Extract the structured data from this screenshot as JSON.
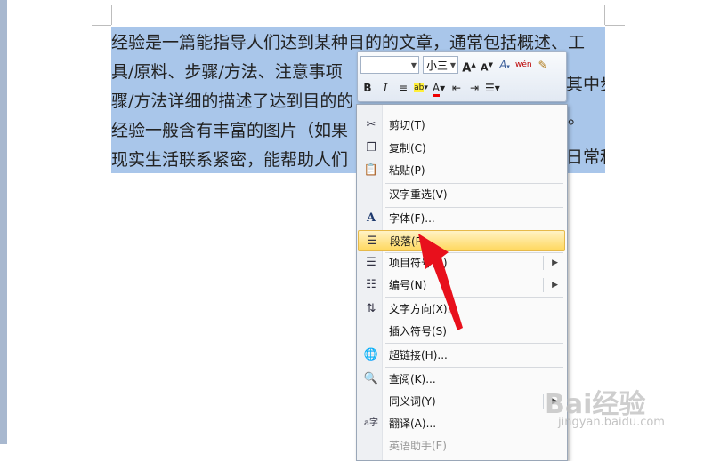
{
  "document": {
    "lines": [
      "经验是一篇能指导人们达到某种目的的文章，通常包括概述、工",
      "具/原料、步骤/方法、注意事项",
      "骤/方法详细的描述了达到目的的",
      "经验一般含有丰富的图片（如果",
      "现实生活联系紧密，能帮助人们"
    ],
    "line2_tail": "其中步",
    "line3_tail": "模仿。",
    "line4_tail": "日常和"
  },
  "mini_toolbar": {
    "font_name": "",
    "font_size": "小三",
    "buttons_row1": [
      "A",
      "A",
      "A",
      "wén",
      "brush"
    ],
    "buttons_row2": [
      "B",
      "I",
      "≡",
      "ab",
      "A",
      "⇤",
      "⇥",
      "☰"
    ]
  },
  "context_menu": {
    "items": [
      {
        "icon": "cut-icon",
        "label": "剪切(T)"
      },
      {
        "icon": "copy-icon",
        "label": "复制(C)"
      },
      {
        "icon": "paste-icon",
        "label": "粘贴(P)"
      },
      {
        "icon": "",
        "label": "汉字重选(V)"
      },
      {
        "icon": "font-icon",
        "label": "字体(F)..."
      },
      {
        "icon": "paragraph-icon",
        "label": "段落(P)...",
        "highlighted": true
      },
      {
        "icon": "bullets-icon",
        "label": "项目符号(B)",
        "submenu": true
      },
      {
        "icon": "numbering-icon",
        "label": "编号(N)",
        "submenu": true
      },
      {
        "icon": "text-direction-icon",
        "label": "文字方向(X)..."
      },
      {
        "icon": "",
        "label": "插入符号(S)"
      },
      {
        "icon": "hyperlink-icon",
        "label": "超链接(H)..."
      },
      {
        "icon": "lookup-icon",
        "label": "查阅(K)..."
      },
      {
        "icon": "",
        "label": "同义词(Y)",
        "submenu": true
      },
      {
        "icon": "translate-icon",
        "label": "翻译(A)..."
      },
      {
        "icon": "",
        "label": "英语助手(E)",
        "disabled": true
      }
    ]
  },
  "watermark": {
    "brand": "Bai经验",
    "url": "jingyan.baidu.com"
  },
  "colors": {
    "selection": "#a9c6ea",
    "highlight_item": "#ffd85e",
    "arrow": "#e8101c"
  }
}
